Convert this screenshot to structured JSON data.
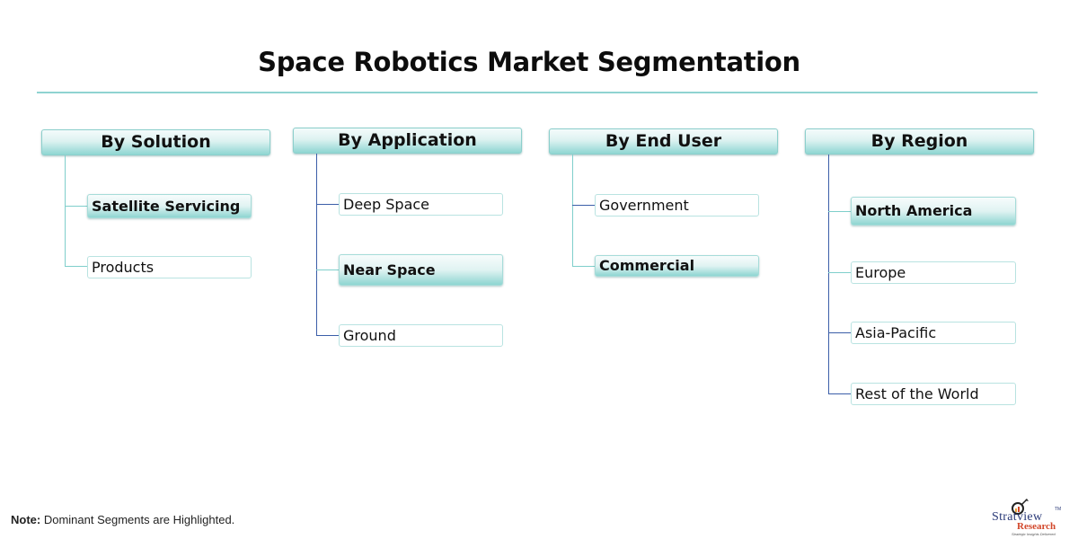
{
  "title": "Space Robotics Market Segmentation",
  "colors": {
    "accent_teal": "#7fcfcb",
    "connector_blue": "#3b5ea8",
    "highlight_gradient_end": "#8ed5d1"
  },
  "segments": [
    {
      "heading": "By Solution",
      "items": [
        {
          "label": "Satellite Servicing",
          "dominant": true
        },
        {
          "label": "Products",
          "dominant": false
        }
      ]
    },
    {
      "heading": "By Application",
      "items": [
        {
          "label": "Deep Space",
          "dominant": false
        },
        {
          "label": "Near Space",
          "dominant": true
        },
        {
          "label": "Ground",
          "dominant": false
        }
      ]
    },
    {
      "heading": "By End User",
      "items": [
        {
          "label": "Government",
          "dominant": false
        },
        {
          "label": "Commercial",
          "dominant": true
        }
      ]
    },
    {
      "heading": "By Region",
      "items": [
        {
          "label": "North America",
          "dominant": true
        },
        {
          "label": "Europe",
          "dominant": false
        },
        {
          "label": "Asia-Pacific",
          "dominant": false
        },
        {
          "label": "Rest of the World",
          "dominant": false
        }
      ]
    }
  ],
  "note": {
    "label": "Note:",
    "text": " Dominant Segments are Highlighted."
  },
  "logo": {
    "brand": "Stratview",
    "trademark": "TM",
    "research": "Research",
    "tagline": "Strategic Insights Delivered",
    "icon": "magnifier-chart-icon"
  }
}
